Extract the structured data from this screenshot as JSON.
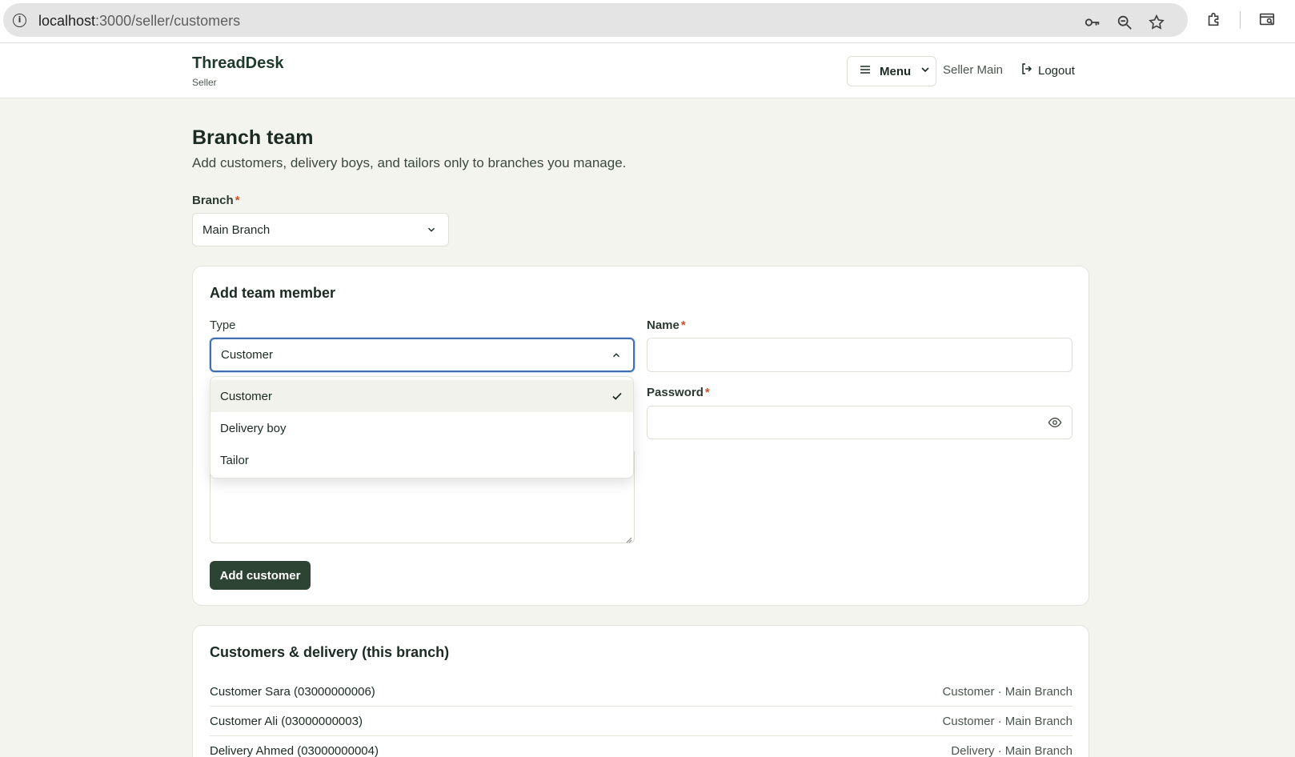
{
  "browser": {
    "url_host": "localhost",
    "url_path": ":3000/seller/customers"
  },
  "header": {
    "brand": "ThreadDesk",
    "role": "Seller",
    "menu_label": "Menu",
    "user_label": "Seller Main",
    "logout_label": "Logout"
  },
  "page": {
    "title": "Branch team",
    "subtitle": "Add customers, delivery boys, and tailors only to branches you manage.",
    "branch_label": "Branch",
    "branch_value": "Main Branch"
  },
  "add_member": {
    "title": "Add team member",
    "type_label": "Type",
    "type_value": "Customer",
    "name_label": "Name",
    "name_value": "",
    "password_label": "Password",
    "password_value": "",
    "type_options": [
      "Customer",
      "Delivery boy",
      "Tailor"
    ],
    "selected_option": "Customer",
    "submit_label": "Add customer"
  },
  "members": {
    "title": "Customers & delivery (this branch)",
    "rows": [
      {
        "name": "Customer Sara (03000000006)",
        "meta": "Customer · Main Branch"
      },
      {
        "name": "Customer Ali (03000000003)",
        "meta": "Customer · Main Branch"
      },
      {
        "name": "Delivery Ahmed (03000000004)",
        "meta": "Delivery · Main Branch"
      }
    ]
  },
  "icons": {
    "info": "info-icon",
    "key": "key-icon",
    "zoom": "zoom-icon",
    "star": "star-icon",
    "extensions": "puzzle-icon",
    "sidepanel": "side-panel-icon",
    "menu": "hamburger-icon",
    "logout": "logout-icon",
    "eye": "eye-icon",
    "check": "check-icon"
  },
  "colors": {
    "background": "#f3f4ee",
    "primary_button": "#2d4434",
    "required": "#c7522a",
    "focus_ring": "#3f6fae"
  }
}
